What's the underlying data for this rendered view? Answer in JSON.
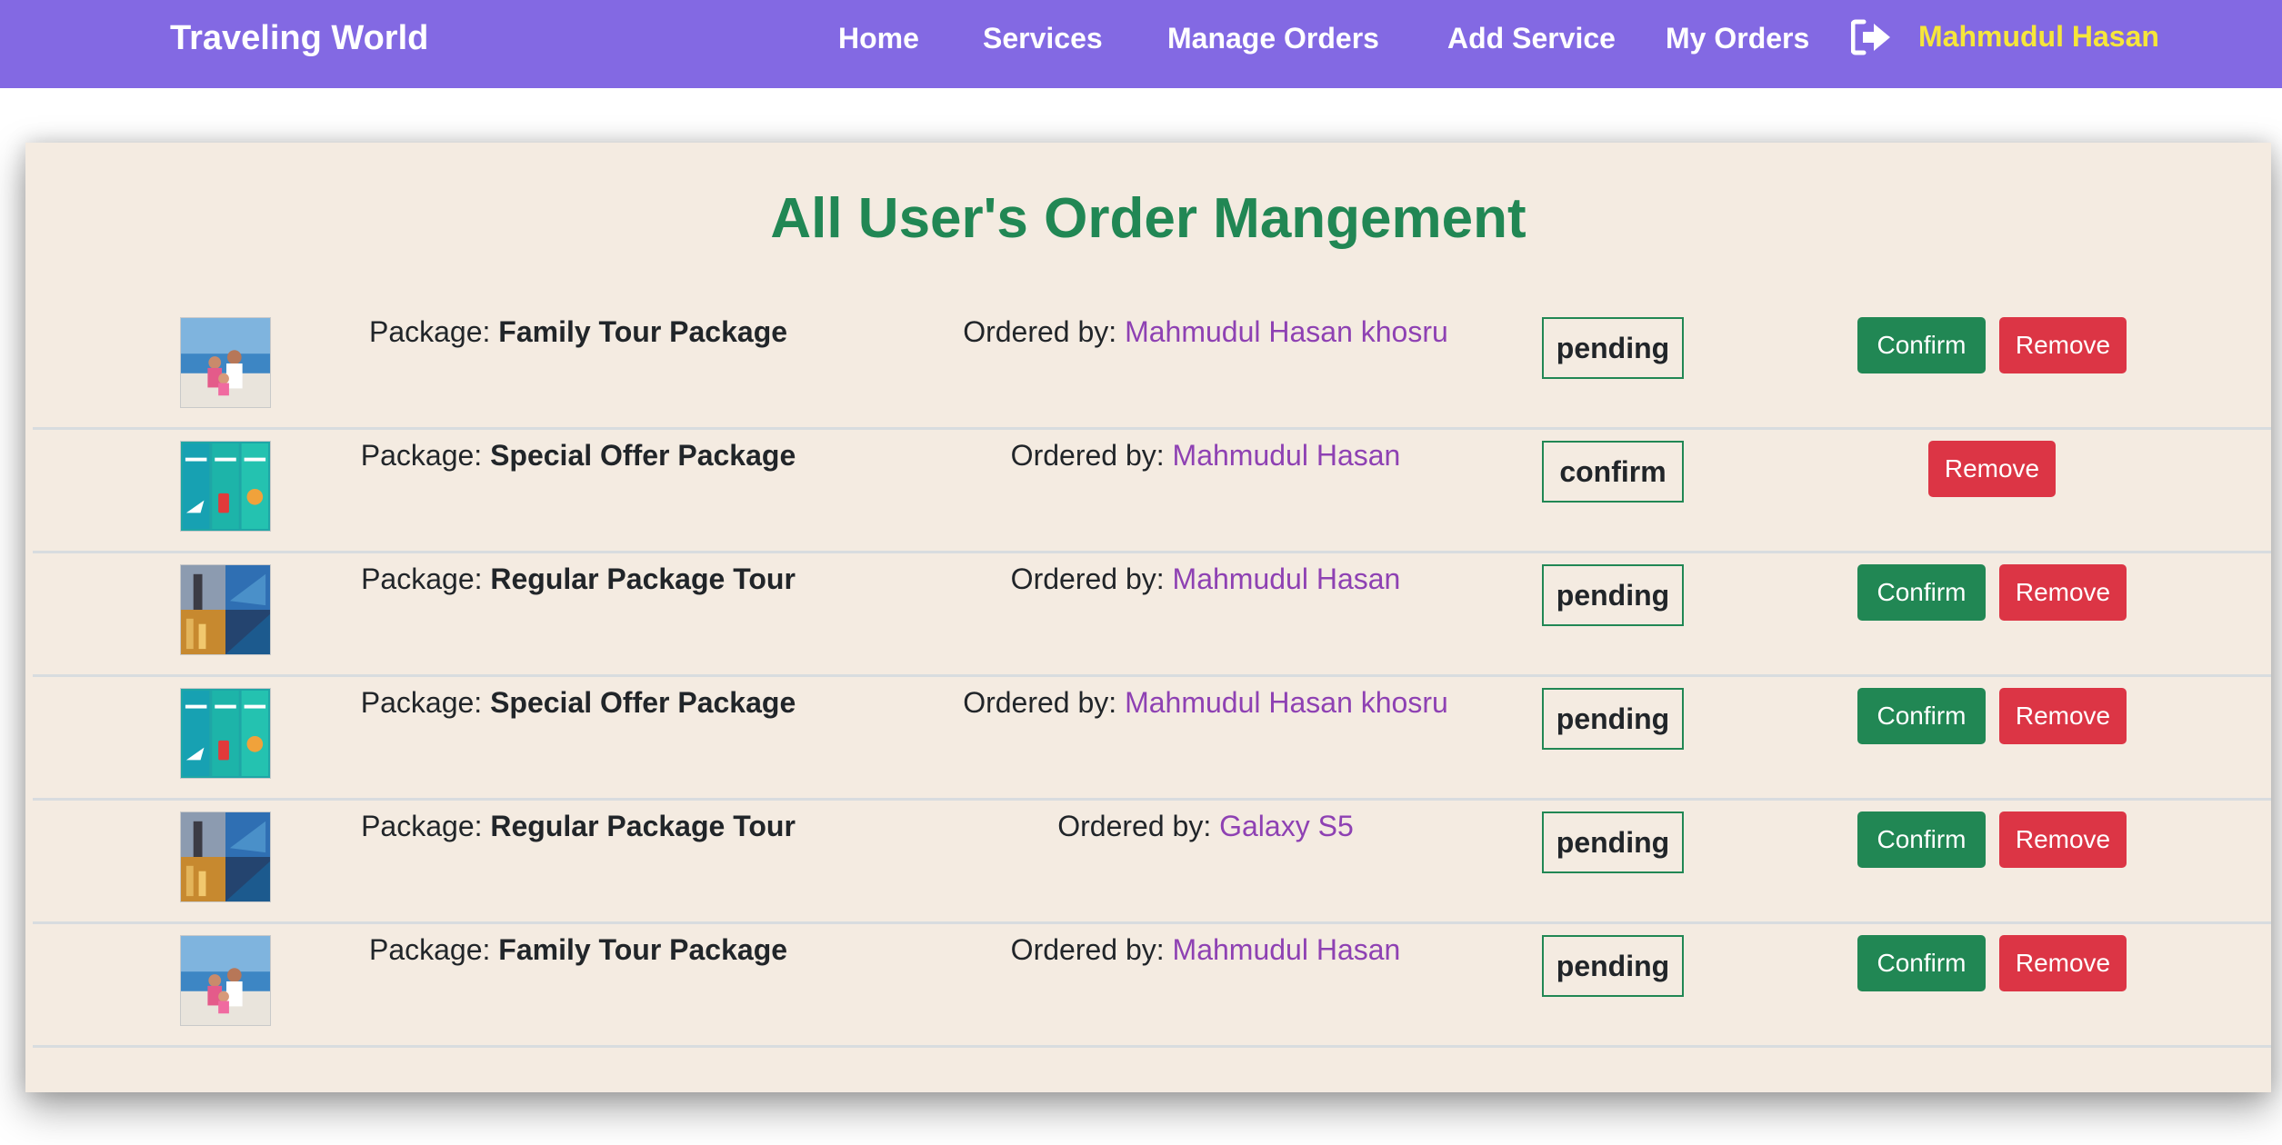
{
  "navbar": {
    "brand": "Traveling World",
    "links": [
      "Home",
      "Services",
      "Manage Orders",
      "Add Service",
      "My Orders"
    ],
    "logout_icon": "sign-out-icon",
    "user_name": "Mahmudul Hasan",
    "colors": {
      "background": "#8369e3",
      "user_name": "#f6e63a"
    }
  },
  "main": {
    "title": "All User's Order Mangement",
    "package_prefix": "Package: ",
    "ordered_prefix": "Ordered by: ",
    "confirm_label": "Confirm",
    "remove_label": "Remove",
    "orders": [
      {
        "image": "family-beach-photo",
        "package": "Family Tour Package",
        "ordered_by": "Mahmudul Hasan khosru",
        "status": "pending"
      },
      {
        "image": "travel-tour-banner",
        "package": "Special Offer Package",
        "ordered_by": "Mahmudul Hasan",
        "status": "confirm"
      },
      {
        "image": "city-coast-collage",
        "package": "Regular Package Tour",
        "ordered_by": "Mahmudul Hasan",
        "status": "pending"
      },
      {
        "image": "travel-tour-banner",
        "package": "Special Offer Package",
        "ordered_by": "Mahmudul Hasan khosru",
        "status": "pending"
      },
      {
        "image": "city-coast-collage",
        "package": "Regular Package Tour",
        "ordered_by": "Galaxy S5",
        "status": "pending"
      },
      {
        "image": "family-beach-photo",
        "package": "Family Tour Package",
        "ordered_by": "Mahmudul Hasan",
        "status": "pending"
      }
    ],
    "colors": {
      "title": "#218754",
      "confirm": "#218754",
      "remove": "#dc3545",
      "orderer": "#8e41b3",
      "card": "#f4ebe1"
    }
  }
}
